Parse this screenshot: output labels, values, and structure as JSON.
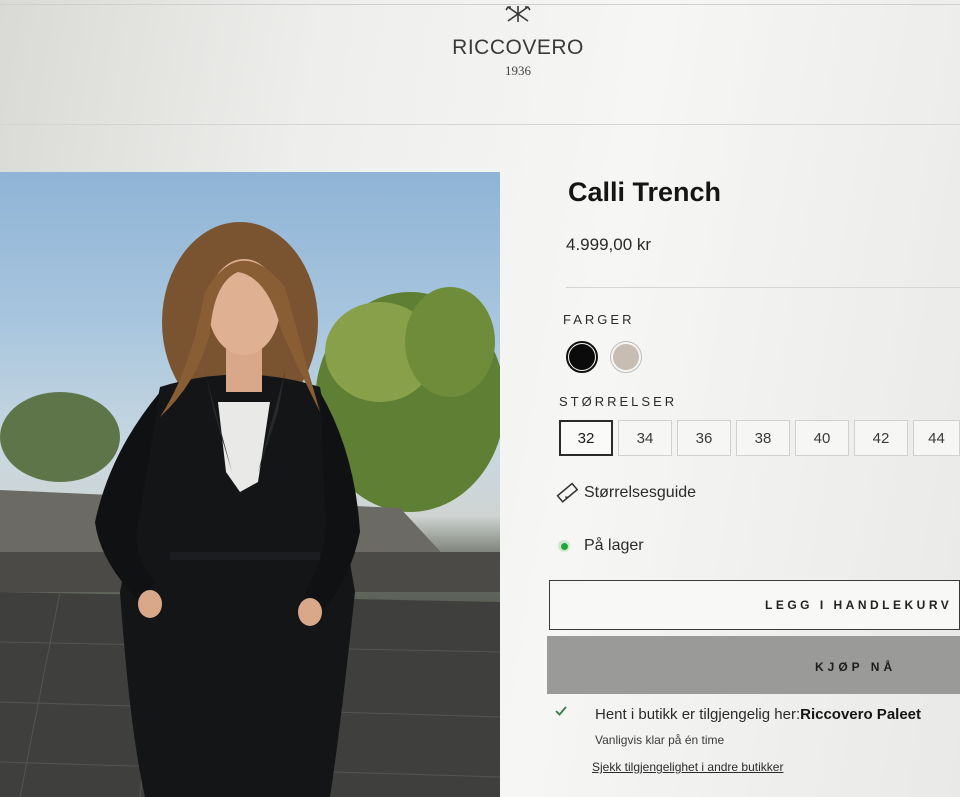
{
  "header": {
    "brand": "RICCOVERO",
    "year": "1936",
    "logo_icon": "crossed-arrows-icon"
  },
  "product": {
    "title": "Calli Trench",
    "price": "4.999,00 kr",
    "image_alt": "Model wearing black trench coat outdoors"
  },
  "colors": {
    "label": "FARGER",
    "options": [
      {
        "name": "black",
        "hex": "#0b0b0b",
        "selected": true
      },
      {
        "name": "beige",
        "hex": "#c8bdb2",
        "selected": false
      }
    ]
  },
  "sizes": {
    "label": "STØRRELSER",
    "options": [
      "32",
      "34",
      "36",
      "38",
      "40",
      "42",
      "44"
    ],
    "selected": "32"
  },
  "size_guide": {
    "label": "Størrelsesguide",
    "icon": "ruler-icon"
  },
  "stock": {
    "label": "På lager",
    "status_color": "#21a43a"
  },
  "actions": {
    "add_to_cart": "LEGG I HANDLEKURV",
    "buy_now": "KJØP NÅ"
  },
  "pickup": {
    "text": "Hent i butikk er tilgjengelig her:",
    "store": "Riccovero Paleet",
    "subtext": "Vanligvis klar på én time",
    "link": "Sjekk tilgjengelighet i andre butikker"
  }
}
